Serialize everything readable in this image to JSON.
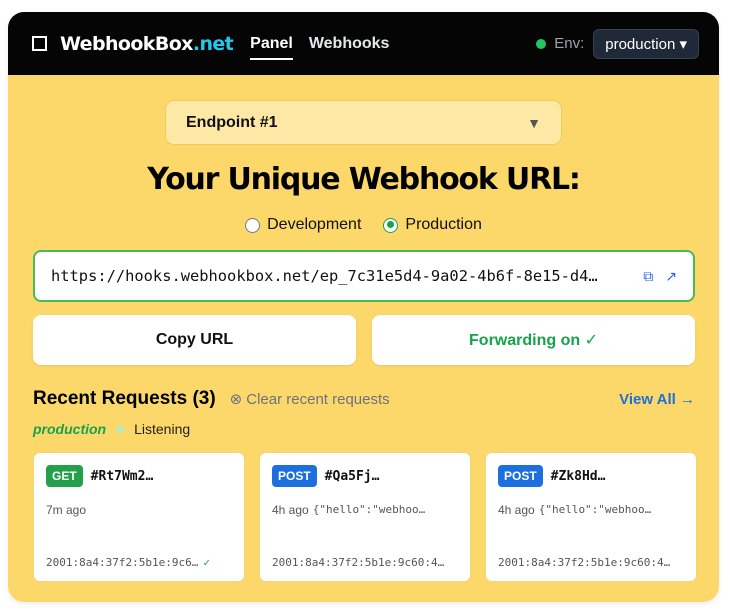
{
  "header": {
    "brand_main": "WebhookBox",
    "brand_tld": ".net",
    "nav": [
      {
        "label": "Panel",
        "active": true
      },
      {
        "label": "Webhooks",
        "active": false
      }
    ],
    "env_label": "Env:",
    "env_value": "production ▾",
    "env_dot_color": "#22c55e"
  },
  "endpoint": {
    "label": "Endpoint #1",
    "caret": "▼"
  },
  "title": "Your Unique Webhook URL:",
  "radios": [
    {
      "label": "Development",
      "checked": false
    },
    {
      "label": "Production",
      "checked": true
    }
  ],
  "url": {
    "value": "https://hooks.webhookbox.net/ep_7c31e5d4-9a02-4b6f-8e15-d4…",
    "copy_icon": "⧉",
    "open_icon": "↗"
  },
  "buttons": {
    "copy": "Copy URL",
    "forwarding": "Forwarding on ✓"
  },
  "recent": {
    "title": "Recent Requests (3)",
    "clear_icon": "⊗",
    "clear_label": "Clear recent requests",
    "view_all": "View All →",
    "env_tag": "production",
    "listening": "Listening"
  },
  "requests": [
    {
      "method": "GET",
      "id": "#Rt7Wm2…",
      "time": "7m ago",
      "body": "",
      "ip": "2001:8a4:37f2:5b1e:9c6…",
      "check": "✓"
    },
    {
      "method": "POST",
      "id": "#Qa5Fj…",
      "time": "4h ago",
      "body": "{\"hello\":\"webhoo…",
      "ip": "2001:8a4:37f2:5b1e:9c60:4…",
      "check": ""
    },
    {
      "method": "POST",
      "id": "#Zk8Hd…",
      "time": "4h ago",
      "body": "{\"hello\":\"webhoo…",
      "ip": "2001:8a4:37f2:5b1e:9c60:4…",
      "check": ""
    }
  ],
  "colors": {
    "accent_bg": "#fcd86b",
    "header_bg": "#050505",
    "success": "#16a34a",
    "link": "#1d70d8"
  }
}
